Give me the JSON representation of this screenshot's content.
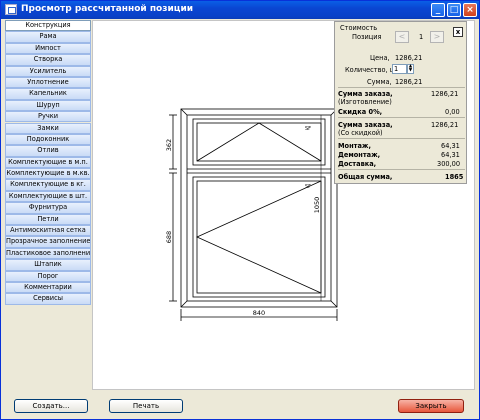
{
  "window": {
    "title": "Просмотр рассчитанной позиции"
  },
  "sidebar": {
    "items": [
      "Конструкция",
      "Рама",
      "Импост",
      "Створка",
      "Усилитель",
      "Уплотнение",
      "Капельник",
      "Шуруп",
      "Ручки",
      "Замки",
      "Подоконник",
      "Отлив",
      "Комплектующие в м.п.",
      "Комплектующие в м.кв.",
      "Комплектующие в кг.",
      "Комплектующие в шт.",
      "Фурнитура",
      "Петли",
      "Антимоскитная сетка",
      "Прозрачное заполнение",
      "Пластиковое заполнение",
      "Штапик",
      "Порог",
      "Комментарии",
      "Сервисы"
    ],
    "active_index": 0
  },
  "drawing": {
    "dim_top_sash": "362",
    "dim_bottom_sash": "688",
    "dim_total_height": "1050",
    "dim_width": "840",
    "mark_top": "SF",
    "mark_bottom": "SF"
  },
  "cost": {
    "legend": "Стоимость",
    "close_label": "x",
    "position_label": "Позиция",
    "position_value": "1",
    "prev_label": "<",
    "next_label": ">",
    "price_label": "Цена,",
    "price_value": "1286,21",
    "qty_label": "Количество, шт",
    "qty_value": "1",
    "sum_label": "Сумма,",
    "sum_value": "1286,21",
    "order_sum_label": "Сумма заказа,",
    "order_sum_sub": "(Изготовление)",
    "order_sum_value": "1286,21",
    "discount_label": "Скидка 0%,",
    "discount_value": "0,00",
    "order_disc_label": "Сумма заказа,",
    "order_disc_sub": "(Со скидкой)",
    "order_disc_value": "1286,21",
    "mount_label": "Монтаж,",
    "mount_value": "64,31",
    "dismount_label": "Демонтаж,",
    "dismount_value": "64,31",
    "delivery_label": "Доставка,",
    "delivery_value": "300,00",
    "total_label": "Общая сумма,",
    "total_value": "1865"
  },
  "buttons": {
    "create": "Создать...",
    "print": "Печать",
    "close": "Закрыть"
  }
}
